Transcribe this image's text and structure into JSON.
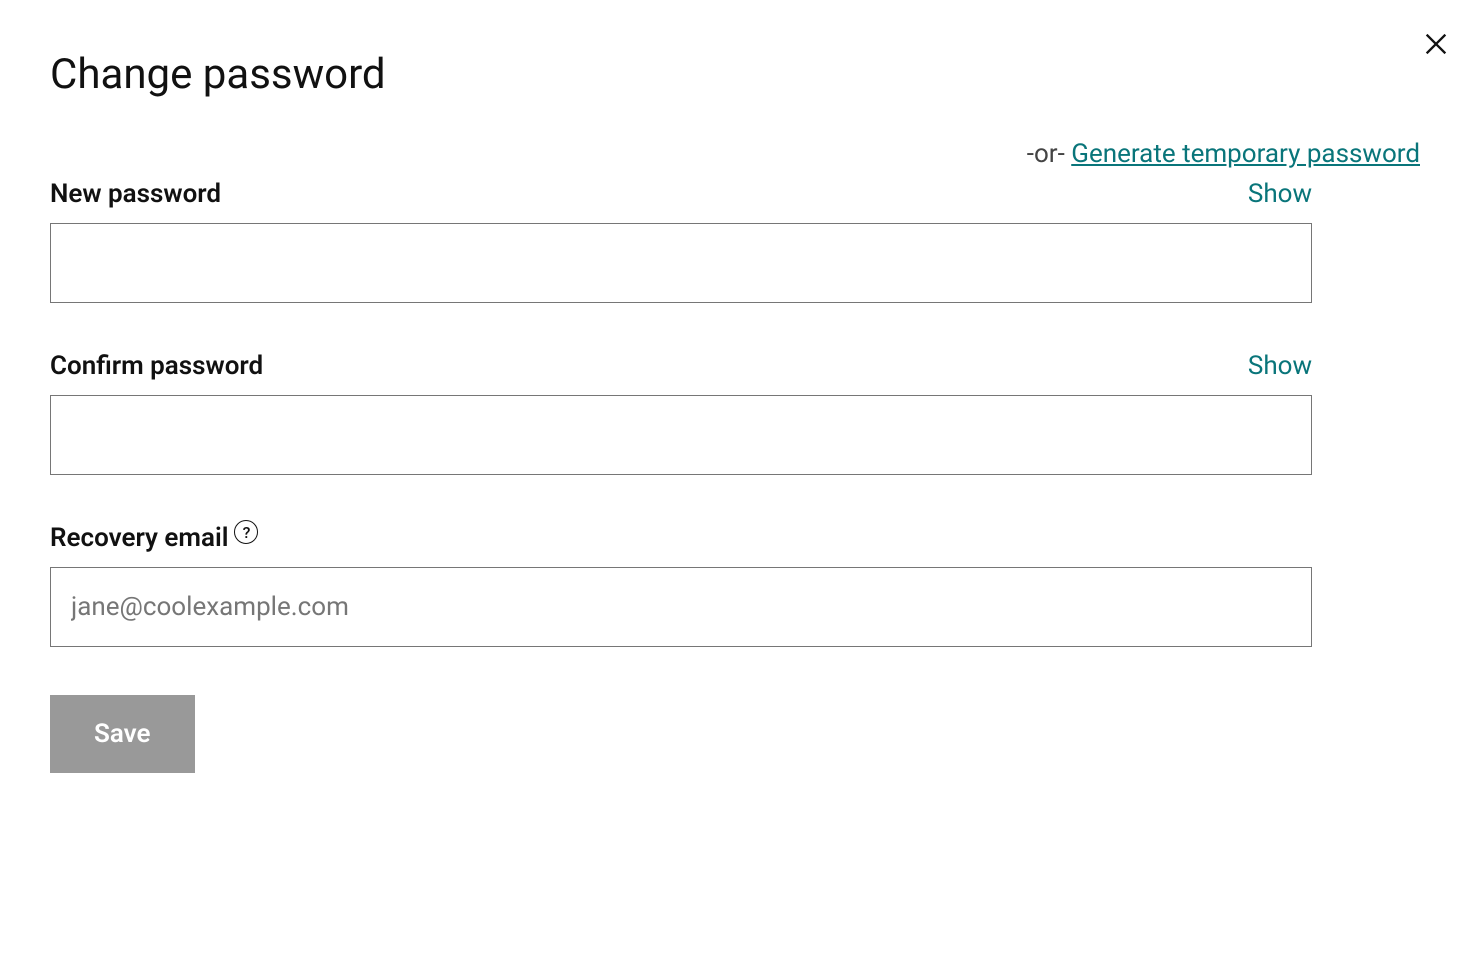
{
  "title": "Change password",
  "or_text": "-or- ",
  "generate_link": "Generate temporary password",
  "fields": {
    "new_password": {
      "label": "New password",
      "show_toggle": "Show",
      "value": ""
    },
    "confirm_password": {
      "label": "Confirm password",
      "show_toggle": "Show",
      "value": ""
    },
    "recovery_email": {
      "label": "Recovery email",
      "placeholder": "jane@coolexample.com",
      "value": "",
      "help_icon": "?"
    }
  },
  "save_button": "Save"
}
